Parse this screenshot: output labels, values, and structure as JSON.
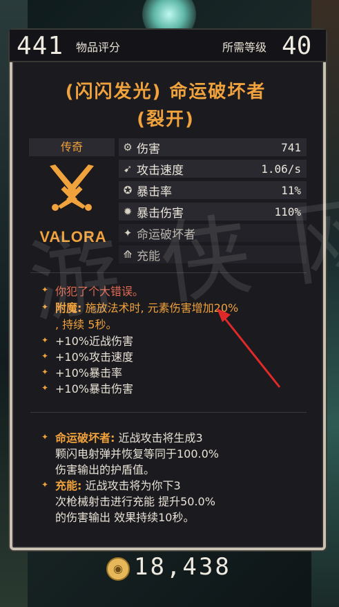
{
  "header": {
    "item_score": "441",
    "item_score_label": "物品评分",
    "required_level_label": "所需等级",
    "required_level": "40"
  },
  "item": {
    "title_line1": "(闪闪发光) 命运破坏者",
    "title_line2": "(裂开)",
    "rarity": "传奇",
    "manufacturer": "VALORA"
  },
  "stats": [
    {
      "icon": "damage-icon",
      "label": "伤害",
      "value": "741"
    },
    {
      "icon": "attack-speed-icon",
      "label": "攻击速度",
      "value": "1.06/s"
    },
    {
      "icon": "crit-rate-icon",
      "label": "暴击率",
      "value": "11%"
    },
    {
      "icon": "crit-damage-icon",
      "label": "暴击伤害",
      "value": "110%"
    },
    {
      "icon": "star-icon",
      "label": "命运破坏者",
      "value": ""
    },
    {
      "icon": "charge-icon",
      "label": "充能",
      "value": ""
    }
  ],
  "flavor": "你犯了个大错误。",
  "enchant": {
    "label": "附魔:",
    "text": "施放法术时, 元素伤害增加20%",
    "text2": ", 持续 5秒。"
  },
  "bonuses": [
    {
      "value": "+10%",
      "label": "近战伤害"
    },
    {
      "value": "+10%",
      "label": "攻击速度"
    },
    {
      "value": "+10%",
      "label": "暴击率"
    },
    {
      "value": "+10%",
      "label": "暴击伤害"
    }
  ],
  "abilities": [
    {
      "name": "命运破坏者:",
      "line1": "近战攻击将生成3",
      "line2": "颗闪电射弹并恢复等同于100.0%",
      "line3": "伤害输出的护盾值。"
    },
    {
      "name": "充能:",
      "line1": "近战攻击将为你下3",
      "line2": "次枪械射击进行充能 提升50.0%",
      "line3": "的伤害输出 效果持续10秒。"
    }
  ],
  "price": "18,438",
  "colors": {
    "accent_orange": "#f0a23c",
    "flavor_red": "#e06a52",
    "panel_bg": "#1b1a1f",
    "arrow_red": "#e02a2a"
  }
}
